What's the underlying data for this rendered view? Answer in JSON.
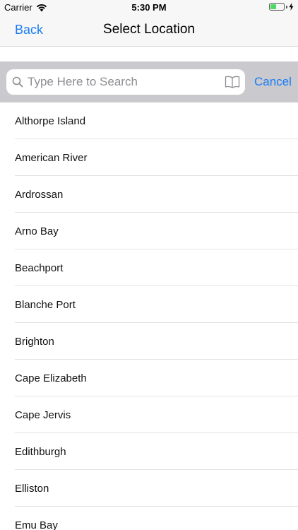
{
  "status_bar": {
    "carrier": "Carrier",
    "time": "5:30 PM",
    "battery_level": 0.45,
    "wifi_icon": "wifi-icon",
    "battery_icon": "battery-icon",
    "charging_icon": "bolt-icon"
  },
  "nav": {
    "back_label": "Back",
    "title": "Select Location"
  },
  "search": {
    "placeholder": "Type Here to Search",
    "value": "",
    "cancel_label": "Cancel",
    "search_icon": "search-icon",
    "bookmark_icon": "book-icon"
  },
  "locations": [
    {
      "label": "Althorpe Island"
    },
    {
      "label": "American River"
    },
    {
      "label": "Ardrossan"
    },
    {
      "label": "Arno Bay"
    },
    {
      "label": "Beachport"
    },
    {
      "label": "Blanche Port"
    },
    {
      "label": "Brighton"
    },
    {
      "label": "Cape Elizabeth"
    },
    {
      "label": "Cape Jervis"
    },
    {
      "label": "Edithburgh"
    },
    {
      "label": "Elliston"
    },
    {
      "label": "Emu Bay"
    }
  ],
  "colors": {
    "accent": "#1c7cf4",
    "bar_background": "#f7f7f7",
    "search_background": "#c9c9ce",
    "battery": "#4cd964"
  }
}
